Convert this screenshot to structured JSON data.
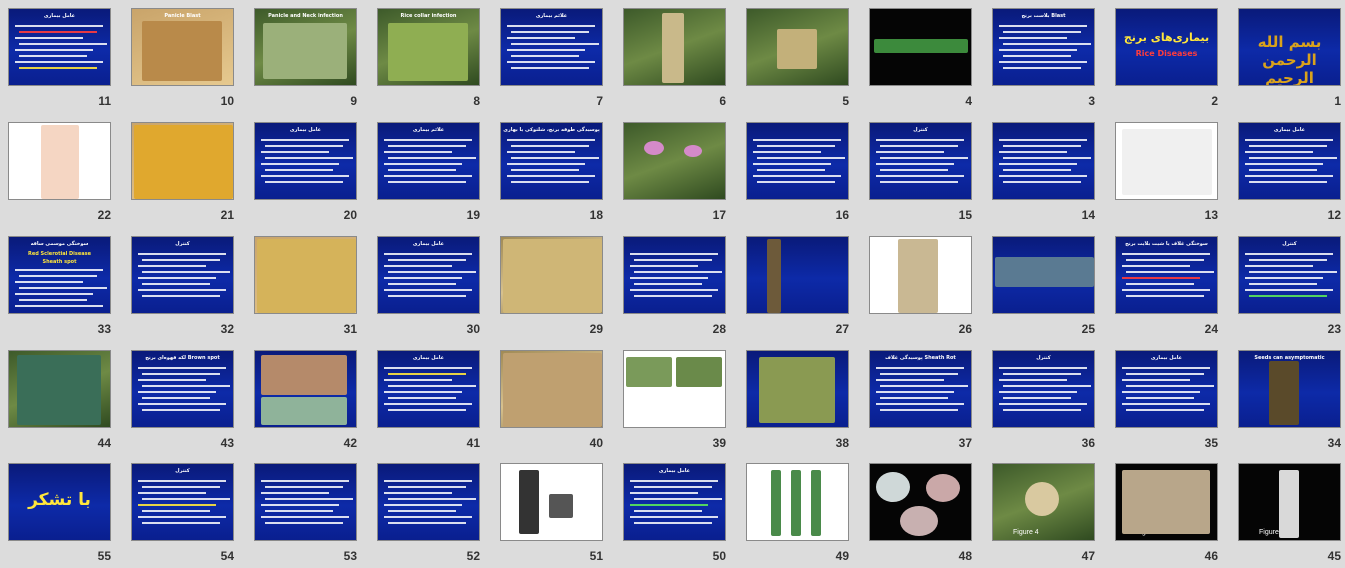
{
  "grid": {
    "rows": [
      {
        "slides": [
          {
            "n": "11",
            "title": "عامل بیماری"
          },
          {
            "n": "10",
            "title": "Panicle Blast"
          },
          {
            "n": "9",
            "title": "Panicle and Neck infection"
          },
          {
            "n": "8",
            "title": "Rice collar infection"
          },
          {
            "n": "7",
            "title": "علائم بیماری"
          },
          {
            "n": "6",
            "title": ""
          },
          {
            "n": "5",
            "title": ""
          },
          {
            "n": "4",
            "title": ""
          },
          {
            "n": "3",
            "title": "بلاست برنج Blast"
          },
          {
            "n": "2",
            "title": "بیماری‌های برنج",
            "subtitle": "Rice Diseases"
          },
          {
            "n": "1",
            "title": "بسم الله الرحمن الرحیم"
          }
        ]
      },
      {
        "slides": [
          {
            "n": "22",
            "title": ""
          },
          {
            "n": "21",
            "title": ""
          },
          {
            "n": "20",
            "title": "عامل بیماری"
          },
          {
            "n": "19",
            "title": "علائم بیماری"
          },
          {
            "n": "18",
            "title": "پوسیدگی طوقه برنج، شلتوکی یا بهاری"
          },
          {
            "n": "17",
            "title": ""
          },
          {
            "n": "16",
            "title": ""
          },
          {
            "n": "15",
            "title": "کنترل"
          },
          {
            "n": "14",
            "title": ""
          },
          {
            "n": "13",
            "title": ""
          },
          {
            "n": "12",
            "title": "عامل بیماری"
          }
        ]
      },
      {
        "slides": [
          {
            "n": "33",
            "title": "سوختگی موسمی ساقه",
            "subtitle": "Red Sclerotial Disease",
            "subtitle2": "Sheath spot"
          },
          {
            "n": "32",
            "title": "کنترل"
          },
          {
            "n": "31",
            "title": ""
          },
          {
            "n": "30",
            "title": "عامل بیماری"
          },
          {
            "n": "29",
            "title": ""
          },
          {
            "n": "28",
            "title": ""
          },
          {
            "n": "27",
            "title": ""
          },
          {
            "n": "26",
            "title": ""
          },
          {
            "n": "25",
            "title": ""
          },
          {
            "n": "24",
            "title": "سوختگی غلاف یا شیت بلایت برنج"
          },
          {
            "n": "23",
            "title": "کنترل"
          }
        ]
      },
      {
        "slides": [
          {
            "n": "44",
            "title": ""
          },
          {
            "n": "43",
            "title": "لکه قهوه‌ای برنج Brown spot"
          },
          {
            "n": "42",
            "title": ""
          },
          {
            "n": "41",
            "title": "عامل بیماری"
          },
          {
            "n": "40",
            "title": ""
          },
          {
            "n": "39",
            "title": ""
          },
          {
            "n": "38",
            "title": ""
          },
          {
            "n": "37",
            "title": "پوسیدگی غلاف Sheath Rot"
          },
          {
            "n": "36",
            "title": "کنترل"
          },
          {
            "n": "35",
            "title": "عامل بیماری"
          },
          {
            "n": "34",
            "title": "Seeds can asymptomatic"
          }
        ]
      },
      {
        "slides": [
          {
            "n": "55",
            "title": "با تشکر"
          },
          {
            "n": "54",
            "title": "کنترل"
          },
          {
            "n": "53",
            "title": ""
          },
          {
            "n": "52",
            "title": ""
          },
          {
            "n": "51",
            "title": ""
          },
          {
            "n": "50",
            "title": "عامل بیماری"
          },
          {
            "n": "49",
            "title": ""
          },
          {
            "n": "48",
            "title": ""
          },
          {
            "n": "47",
            "title": "",
            "caption": "Figure 4"
          },
          {
            "n": "46",
            "title": "",
            "caption": "Figure 3"
          },
          {
            "n": "45",
            "title": "",
            "caption": "Figure 2"
          }
        ]
      }
    ]
  },
  "colors": {
    "background": "#dcdcdc",
    "slide_blue": "#0d2aa8",
    "number": "#333333",
    "accent_yellow": "#ffe63c",
    "accent_red": "#ff3c3c"
  }
}
